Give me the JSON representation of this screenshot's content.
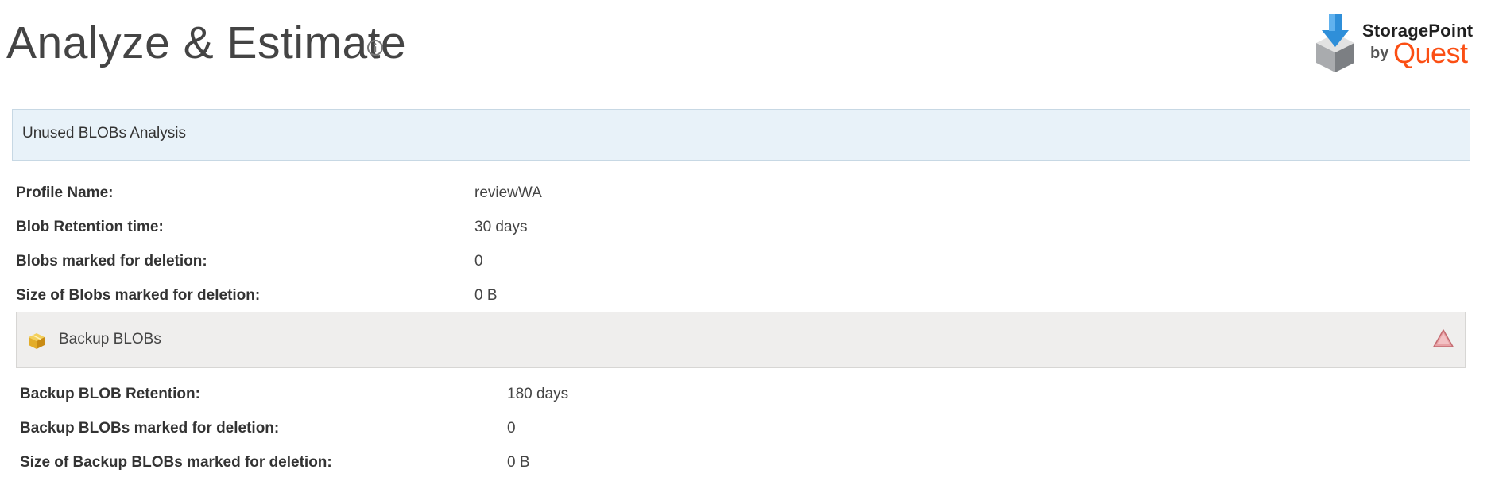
{
  "header": {
    "title": "Analyze & Estimate",
    "info_icon": "info-circle-icon"
  },
  "logo": {
    "name": "StoragePoint",
    "by": "by",
    "vendor": "Quest",
    "brand_color": "#fb4f14",
    "icon": "storage-box-download-icon"
  },
  "analysis": {
    "title": "Unused BLOBs Analysis",
    "header_color": "#e8f2f9",
    "fields": [
      {
        "label": "Profile Name:",
        "value": "reviewWA"
      },
      {
        "label": "Blob Retention time:",
        "value": "30 days"
      },
      {
        "label": "Blobs marked for deletion:",
        "value": "0"
      },
      {
        "label": "Size of Blobs marked for deletion:",
        "value": "0 B"
      }
    ]
  },
  "backup": {
    "title": "Backup BLOBs",
    "icon": "backup-box-icon",
    "toggle_icon": "warning-triangle-icon",
    "header_color": "#efeeed",
    "fields": [
      {
        "label": "Backup BLOB Retention:",
        "value": "180 days"
      },
      {
        "label": "Backup BLOBs marked for deletion:",
        "value": "0"
      },
      {
        "label": "Size of Backup BLOBs marked for deletion:",
        "value": "0 B"
      }
    ]
  }
}
